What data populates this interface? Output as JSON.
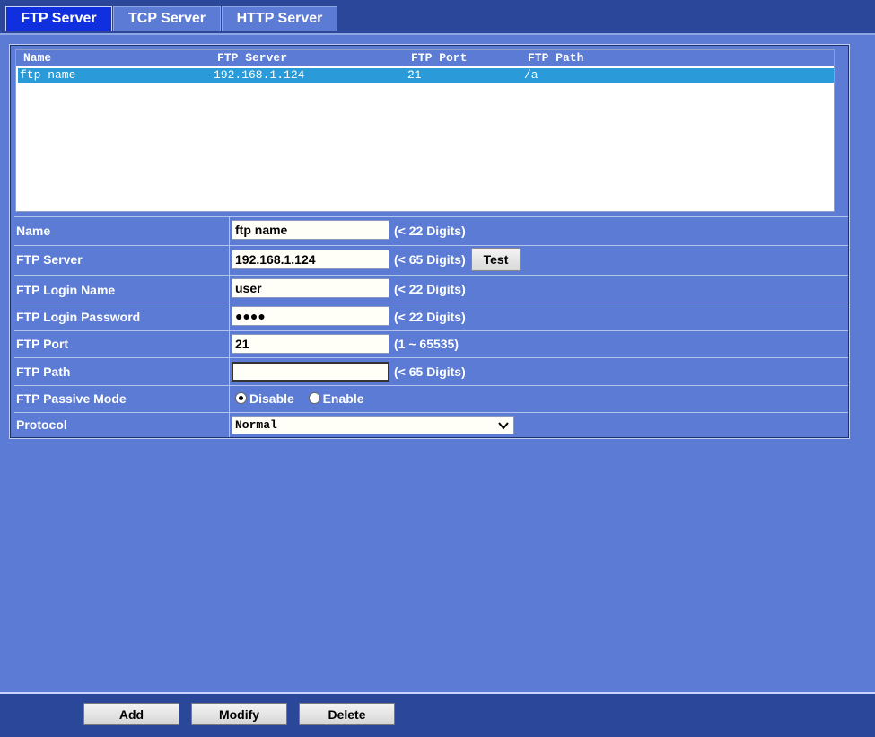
{
  "tabs": [
    {
      "label": "FTP Server",
      "active": true
    },
    {
      "label": "TCP Server",
      "active": false
    },
    {
      "label": "HTTP Server",
      "active": false
    }
  ],
  "list": {
    "columns": [
      "Name",
      "FTP Server",
      "FTP Port",
      "FTP Path"
    ],
    "rows": [
      {
        "name": "ftp name",
        "server": "192.168.1.124",
        "port": "21",
        "path": "/a",
        "selected": true
      }
    ]
  },
  "form": {
    "name": {
      "label": "Name",
      "value": "ftp name",
      "hint": "(< 22 Digits)"
    },
    "server": {
      "label": "FTP Server",
      "value": "192.168.1.124",
      "hint": "(< 65 Digits)",
      "test_label": "Test"
    },
    "login": {
      "label": "FTP Login Name",
      "value": "user",
      "hint": "(< 22 Digits)"
    },
    "password": {
      "label": "FTP Login Password",
      "value": "●●●●",
      "hint": "(< 22 Digits)"
    },
    "port": {
      "label": "FTP Port",
      "value": "21",
      "hint": "(1 ~ 65535)"
    },
    "path": {
      "label": "FTP Path",
      "value": "",
      "hint": "(< 65 Digits)"
    },
    "passive": {
      "label": "FTP Passive Mode",
      "options": [
        "Disable",
        "Enable"
      ],
      "selected": "Disable"
    },
    "protocol": {
      "label": "Protocol",
      "value": "Normal"
    }
  },
  "buttons": {
    "add": "Add",
    "modify": "Modify",
    "delete": "Delete"
  },
  "colors": {
    "background": "#5b7bd5",
    "bar": "#2a4799",
    "active_tab": "#1030e0",
    "selected_row": "#2a9ad8"
  }
}
